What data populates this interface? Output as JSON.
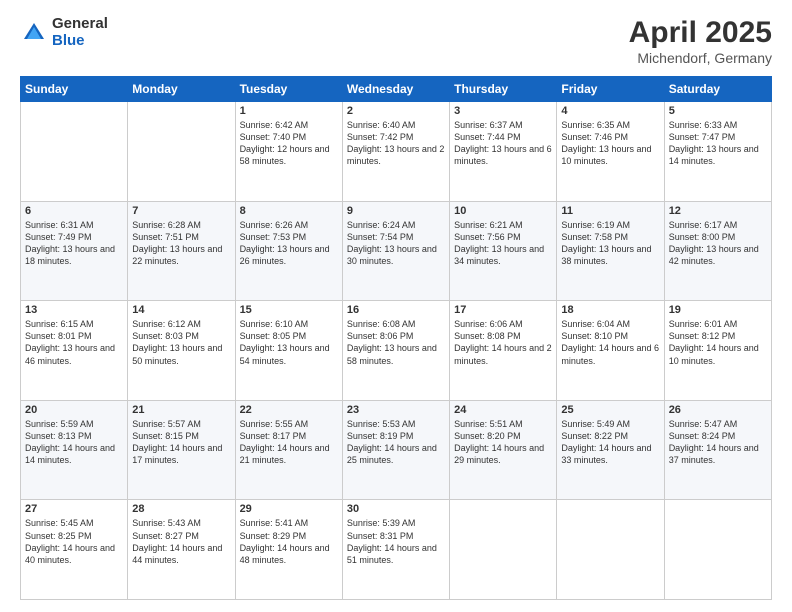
{
  "header": {
    "logo_general": "General",
    "logo_blue": "Blue",
    "title": "April 2025",
    "location": "Michendorf, Germany"
  },
  "days_of_week": [
    "Sunday",
    "Monday",
    "Tuesday",
    "Wednesday",
    "Thursday",
    "Friday",
    "Saturday"
  ],
  "weeks": [
    [
      {
        "day": "",
        "info": ""
      },
      {
        "day": "",
        "info": ""
      },
      {
        "day": "1",
        "info": "Sunrise: 6:42 AM\nSunset: 7:40 PM\nDaylight: 12 hours and 58 minutes."
      },
      {
        "day": "2",
        "info": "Sunrise: 6:40 AM\nSunset: 7:42 PM\nDaylight: 13 hours and 2 minutes."
      },
      {
        "day": "3",
        "info": "Sunrise: 6:37 AM\nSunset: 7:44 PM\nDaylight: 13 hours and 6 minutes."
      },
      {
        "day": "4",
        "info": "Sunrise: 6:35 AM\nSunset: 7:46 PM\nDaylight: 13 hours and 10 minutes."
      },
      {
        "day": "5",
        "info": "Sunrise: 6:33 AM\nSunset: 7:47 PM\nDaylight: 13 hours and 14 minutes."
      }
    ],
    [
      {
        "day": "6",
        "info": "Sunrise: 6:31 AM\nSunset: 7:49 PM\nDaylight: 13 hours and 18 minutes."
      },
      {
        "day": "7",
        "info": "Sunrise: 6:28 AM\nSunset: 7:51 PM\nDaylight: 13 hours and 22 minutes."
      },
      {
        "day": "8",
        "info": "Sunrise: 6:26 AM\nSunset: 7:53 PM\nDaylight: 13 hours and 26 minutes."
      },
      {
        "day": "9",
        "info": "Sunrise: 6:24 AM\nSunset: 7:54 PM\nDaylight: 13 hours and 30 minutes."
      },
      {
        "day": "10",
        "info": "Sunrise: 6:21 AM\nSunset: 7:56 PM\nDaylight: 13 hours and 34 minutes."
      },
      {
        "day": "11",
        "info": "Sunrise: 6:19 AM\nSunset: 7:58 PM\nDaylight: 13 hours and 38 minutes."
      },
      {
        "day": "12",
        "info": "Sunrise: 6:17 AM\nSunset: 8:00 PM\nDaylight: 13 hours and 42 minutes."
      }
    ],
    [
      {
        "day": "13",
        "info": "Sunrise: 6:15 AM\nSunset: 8:01 PM\nDaylight: 13 hours and 46 minutes."
      },
      {
        "day": "14",
        "info": "Sunrise: 6:12 AM\nSunset: 8:03 PM\nDaylight: 13 hours and 50 minutes."
      },
      {
        "day": "15",
        "info": "Sunrise: 6:10 AM\nSunset: 8:05 PM\nDaylight: 13 hours and 54 minutes."
      },
      {
        "day": "16",
        "info": "Sunrise: 6:08 AM\nSunset: 8:06 PM\nDaylight: 13 hours and 58 minutes."
      },
      {
        "day": "17",
        "info": "Sunrise: 6:06 AM\nSunset: 8:08 PM\nDaylight: 14 hours and 2 minutes."
      },
      {
        "day": "18",
        "info": "Sunrise: 6:04 AM\nSunset: 8:10 PM\nDaylight: 14 hours and 6 minutes."
      },
      {
        "day": "19",
        "info": "Sunrise: 6:01 AM\nSunset: 8:12 PM\nDaylight: 14 hours and 10 minutes."
      }
    ],
    [
      {
        "day": "20",
        "info": "Sunrise: 5:59 AM\nSunset: 8:13 PM\nDaylight: 14 hours and 14 minutes."
      },
      {
        "day": "21",
        "info": "Sunrise: 5:57 AM\nSunset: 8:15 PM\nDaylight: 14 hours and 17 minutes."
      },
      {
        "day": "22",
        "info": "Sunrise: 5:55 AM\nSunset: 8:17 PM\nDaylight: 14 hours and 21 minutes."
      },
      {
        "day": "23",
        "info": "Sunrise: 5:53 AM\nSunset: 8:19 PM\nDaylight: 14 hours and 25 minutes."
      },
      {
        "day": "24",
        "info": "Sunrise: 5:51 AM\nSunset: 8:20 PM\nDaylight: 14 hours and 29 minutes."
      },
      {
        "day": "25",
        "info": "Sunrise: 5:49 AM\nSunset: 8:22 PM\nDaylight: 14 hours and 33 minutes."
      },
      {
        "day": "26",
        "info": "Sunrise: 5:47 AM\nSunset: 8:24 PM\nDaylight: 14 hours and 37 minutes."
      }
    ],
    [
      {
        "day": "27",
        "info": "Sunrise: 5:45 AM\nSunset: 8:25 PM\nDaylight: 14 hours and 40 minutes."
      },
      {
        "day": "28",
        "info": "Sunrise: 5:43 AM\nSunset: 8:27 PM\nDaylight: 14 hours and 44 minutes."
      },
      {
        "day": "29",
        "info": "Sunrise: 5:41 AM\nSunset: 8:29 PM\nDaylight: 14 hours and 48 minutes."
      },
      {
        "day": "30",
        "info": "Sunrise: 5:39 AM\nSunset: 8:31 PM\nDaylight: 14 hours and 51 minutes."
      },
      {
        "day": "",
        "info": ""
      },
      {
        "day": "",
        "info": ""
      },
      {
        "day": "",
        "info": ""
      }
    ]
  ]
}
